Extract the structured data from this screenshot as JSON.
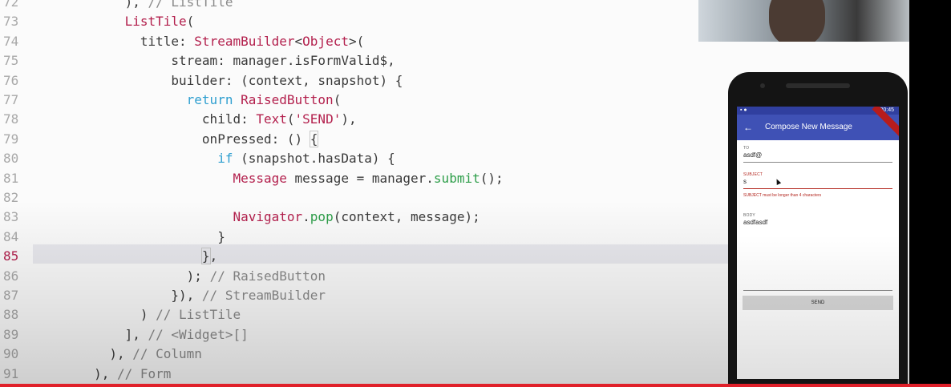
{
  "editor": {
    "lines": [
      {
        "num": "72",
        "segments": [
          {
            "t": "            ), ",
            "c": "plain"
          },
          {
            "t": "// ListTile",
            "c": "cm"
          }
        ]
      },
      {
        "num": "73",
        "segments": [
          {
            "t": "            ",
            "c": "plain"
          },
          {
            "t": "ListTile",
            "c": "cls"
          },
          {
            "t": "(",
            "c": "plain"
          }
        ]
      },
      {
        "num": "74",
        "segments": [
          {
            "t": "              title: ",
            "c": "plain"
          },
          {
            "t": "StreamBuilder",
            "c": "cls"
          },
          {
            "t": "<",
            "c": "plain"
          },
          {
            "t": "Object",
            "c": "cls"
          },
          {
            "t": ">(",
            "c": "plain"
          }
        ]
      },
      {
        "num": "75",
        "segments": [
          {
            "t": "                  stream: manager.isFormValid$,",
            "c": "plain"
          }
        ]
      },
      {
        "num": "76",
        "segments": [
          {
            "t": "                  builder: (context, snapshot) {",
            "c": "plain"
          }
        ]
      },
      {
        "num": "77",
        "segments": [
          {
            "t": "                    ",
            "c": "plain"
          },
          {
            "t": "return ",
            "c": "kw"
          },
          {
            "t": "RaisedButton",
            "c": "cls"
          },
          {
            "t": "(",
            "c": "plain"
          }
        ]
      },
      {
        "num": "78",
        "segments": [
          {
            "t": "                      child: ",
            "c": "plain"
          },
          {
            "t": "Text",
            "c": "cls"
          },
          {
            "t": "(",
            "c": "plain"
          },
          {
            "t": "'SEND'",
            "c": "str"
          },
          {
            "t": "),",
            "c": "plain"
          }
        ]
      },
      {
        "num": "79",
        "segments": [
          {
            "t": "                      onPressed: () ",
            "c": "plain"
          },
          {
            "t": "{",
            "c": "box"
          }
        ]
      },
      {
        "num": "80",
        "segments": [
          {
            "t": "                        ",
            "c": "plain"
          },
          {
            "t": "if ",
            "c": "kw"
          },
          {
            "t": "(snapshot.hasData) {",
            "c": "plain"
          }
        ]
      },
      {
        "num": "81",
        "segments": [
          {
            "t": "                          ",
            "c": "plain"
          },
          {
            "t": "Message",
            "c": "cls"
          },
          {
            "t": " message = manager.",
            "c": "plain"
          },
          {
            "t": "submit",
            "c": "fn"
          },
          {
            "t": "();",
            "c": "plain"
          }
        ]
      },
      {
        "num": "82",
        "segments": [
          {
            "t": "",
            "c": "plain"
          }
        ]
      },
      {
        "num": "83",
        "segments": [
          {
            "t": "                          ",
            "c": "plain"
          },
          {
            "t": "Navigator",
            "c": "cls"
          },
          {
            "t": ".",
            "c": "plain"
          },
          {
            "t": "pop",
            "c": "fn"
          },
          {
            "t": "(context, message);",
            "c": "plain"
          }
        ]
      },
      {
        "num": "84",
        "segments": [
          {
            "t": "                        }",
            "c": "plain"
          }
        ]
      },
      {
        "num": "85",
        "current": true,
        "segments": [
          {
            "t": "                      ",
            "c": "plain"
          },
          {
            "t": "}",
            "c": "box"
          },
          {
            "t": ",",
            "c": "plain"
          }
        ]
      },
      {
        "num": "86",
        "segments": [
          {
            "t": "                    ); ",
            "c": "plain"
          },
          {
            "t": "// RaisedButton",
            "c": "cm"
          }
        ]
      },
      {
        "num": "87",
        "segments": [
          {
            "t": "                  }), ",
            "c": "plain"
          },
          {
            "t": "// StreamBuilder",
            "c": "cm"
          }
        ]
      },
      {
        "num": "88",
        "segments": [
          {
            "t": "              ) ",
            "c": "plain"
          },
          {
            "t": "// ListTile",
            "c": "cm"
          }
        ]
      },
      {
        "num": "89",
        "segments": [
          {
            "t": "            ], ",
            "c": "plain"
          },
          {
            "t": "// <Widget>[]",
            "c": "cm"
          }
        ]
      },
      {
        "num": "90",
        "segments": [
          {
            "t": "          ), ",
            "c": "plain"
          },
          {
            "t": "// Column",
            "c": "cm"
          }
        ]
      },
      {
        "num": "91",
        "segments": [
          {
            "t": "        ), ",
            "c": "plain"
          },
          {
            "t": "// Form",
            "c": "cm"
          }
        ]
      }
    ]
  },
  "phone": {
    "status_time": "20:45",
    "status_left": "▪ ●",
    "back_icon": "←",
    "title": "Compose New Message",
    "to": {
      "label": "TO",
      "value": "asdf@"
    },
    "subject": {
      "label": "SUBJECT",
      "value": "s",
      "error": "SUBJECT must be longer than 4 characters"
    },
    "body": {
      "label": "BODY",
      "value": "asdfasdf"
    },
    "send_label": "SEND"
  },
  "colors": {
    "app_bar": "#3f51b5",
    "status_bar": "#303f9f",
    "error": "#b3261e",
    "progress": "#e0202a"
  }
}
